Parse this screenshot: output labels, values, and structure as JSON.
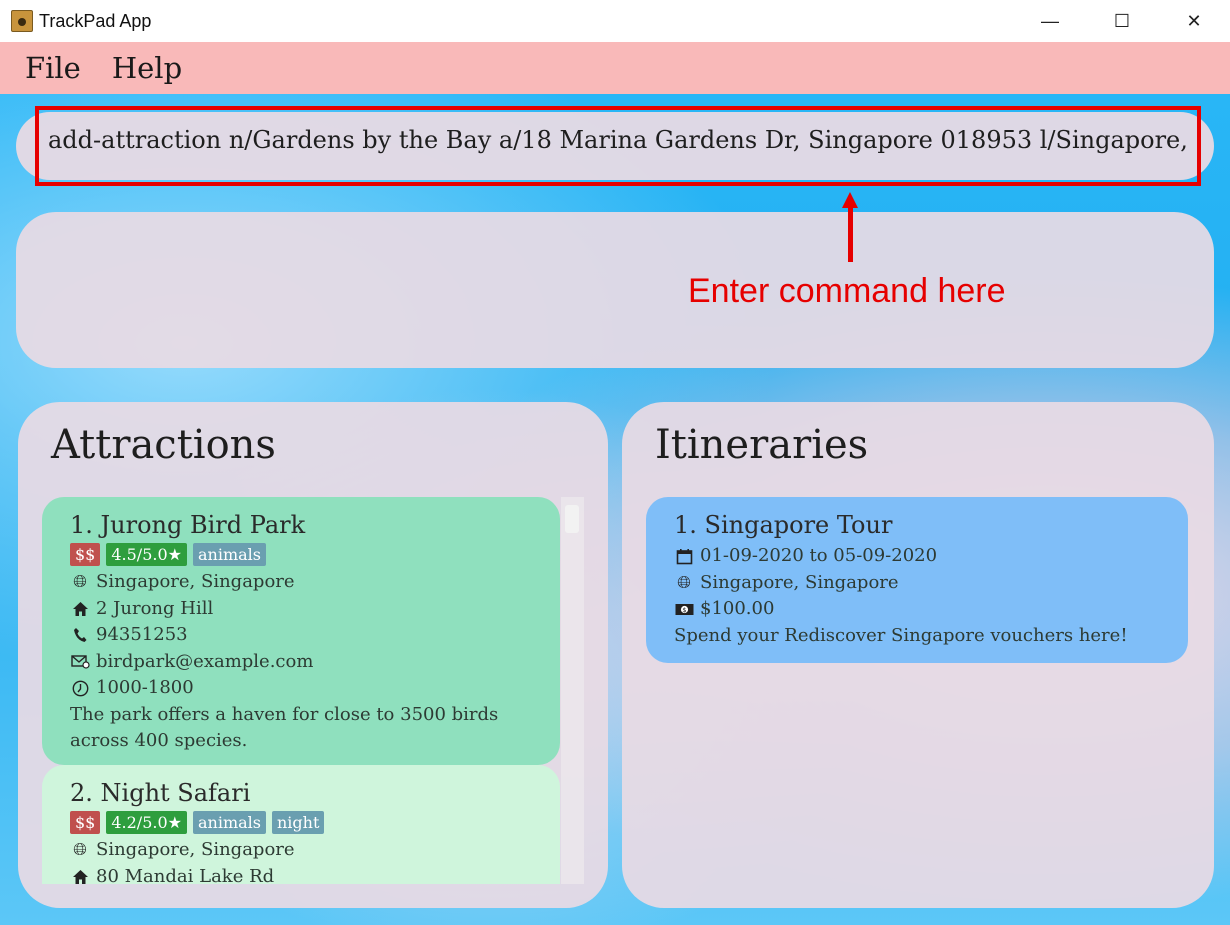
{
  "window": {
    "title": "TrackPad App",
    "controls": {
      "minimize": "—",
      "maximize": "☐",
      "close": "✕"
    }
  },
  "menu": {
    "file": "File",
    "help": "Help"
  },
  "command": {
    "value": "add-attraction n/Gardens by the Bay a/18 Marina Gardens Dr, Singapore 018953 l/Singapore,"
  },
  "annotation": {
    "text": "Enter command here"
  },
  "attractions": {
    "title": "Attractions",
    "items": [
      {
        "title": "1.  Jurong Bird Park",
        "price": "$$",
        "rating": "4.5/5.0★",
        "tags": [
          "animals"
        ],
        "location": "Singapore, Singapore",
        "address": "2 Jurong Hill",
        "phone": "94351253",
        "email": "birdpark@example.com",
        "hours": "1000-1800",
        "description": "The park offers a haven for close to 3500 birds across 400 species."
      },
      {
        "title": "2.  Night Safari",
        "price": "$$",
        "rating": "4.2/5.0★",
        "tags": [
          "animals",
          "night"
        ],
        "location": "Singapore, Singapore",
        "address": "80 Mandai Lake Rd"
      }
    ]
  },
  "itineraries": {
    "title": "Itineraries",
    "items": [
      {
        "title": "1.  Singapore Tour",
        "dates": "01-09-2020 to 05-09-2020",
        "location": "Singapore, Singapore",
        "budget": "$100.00",
        "description": "Spend your Rediscover Singapore vouchers here!"
      }
    ]
  },
  "icons": {
    "location": "globe-icon",
    "address": "home-icon",
    "phone": "phone-icon",
    "email": "email-icon",
    "hours": "clock-icon",
    "dates": "calendar-icon",
    "budget": "money-icon"
  },
  "colors": {
    "menubar": "#f9b9b9",
    "annotation": "#e60000",
    "attraction_selected": "#8fe0be",
    "attraction_default": "#cff5dc",
    "itinerary_card": "#7fbef8"
  }
}
